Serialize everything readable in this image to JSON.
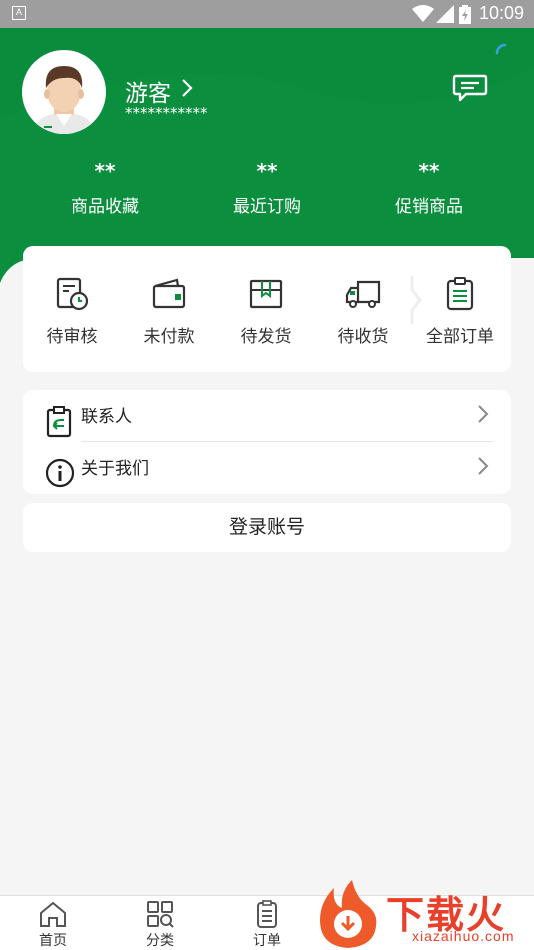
{
  "status_bar": {
    "app_badge": "A",
    "time": "10:09"
  },
  "profile": {
    "name": "游客",
    "masked_id": "***********"
  },
  "stats": [
    {
      "value": "**",
      "label": "商品收藏"
    },
    {
      "value": "**",
      "label": "最近订购"
    },
    {
      "value": "**",
      "label": "促销商品"
    }
  ],
  "orders": [
    {
      "label": "待审核",
      "icon": "pending-review-icon"
    },
    {
      "label": "未付款",
      "icon": "wallet-icon"
    },
    {
      "label": "待发货",
      "icon": "package-icon"
    },
    {
      "label": "待收货",
      "icon": "truck-icon"
    },
    {
      "label": "全部订单",
      "icon": "clipboard-list-icon"
    }
  ],
  "menu": [
    {
      "label": "联系人",
      "icon": "contact-clipboard-icon"
    },
    {
      "label": "关于我们",
      "icon": "info-icon"
    }
  ],
  "login_label": "登录账号",
  "bottom_nav": [
    {
      "label": "首页",
      "icon": "home-icon"
    },
    {
      "label": "分类",
      "icon": "category-search-icon"
    },
    {
      "label": "订单",
      "icon": "order-icon"
    }
  ],
  "watermark": {
    "text": "下载火",
    "sub": "xiazaihuo.com"
  },
  "colors": {
    "brand": "#0b8f3e",
    "watermark": "#e8402a"
  }
}
